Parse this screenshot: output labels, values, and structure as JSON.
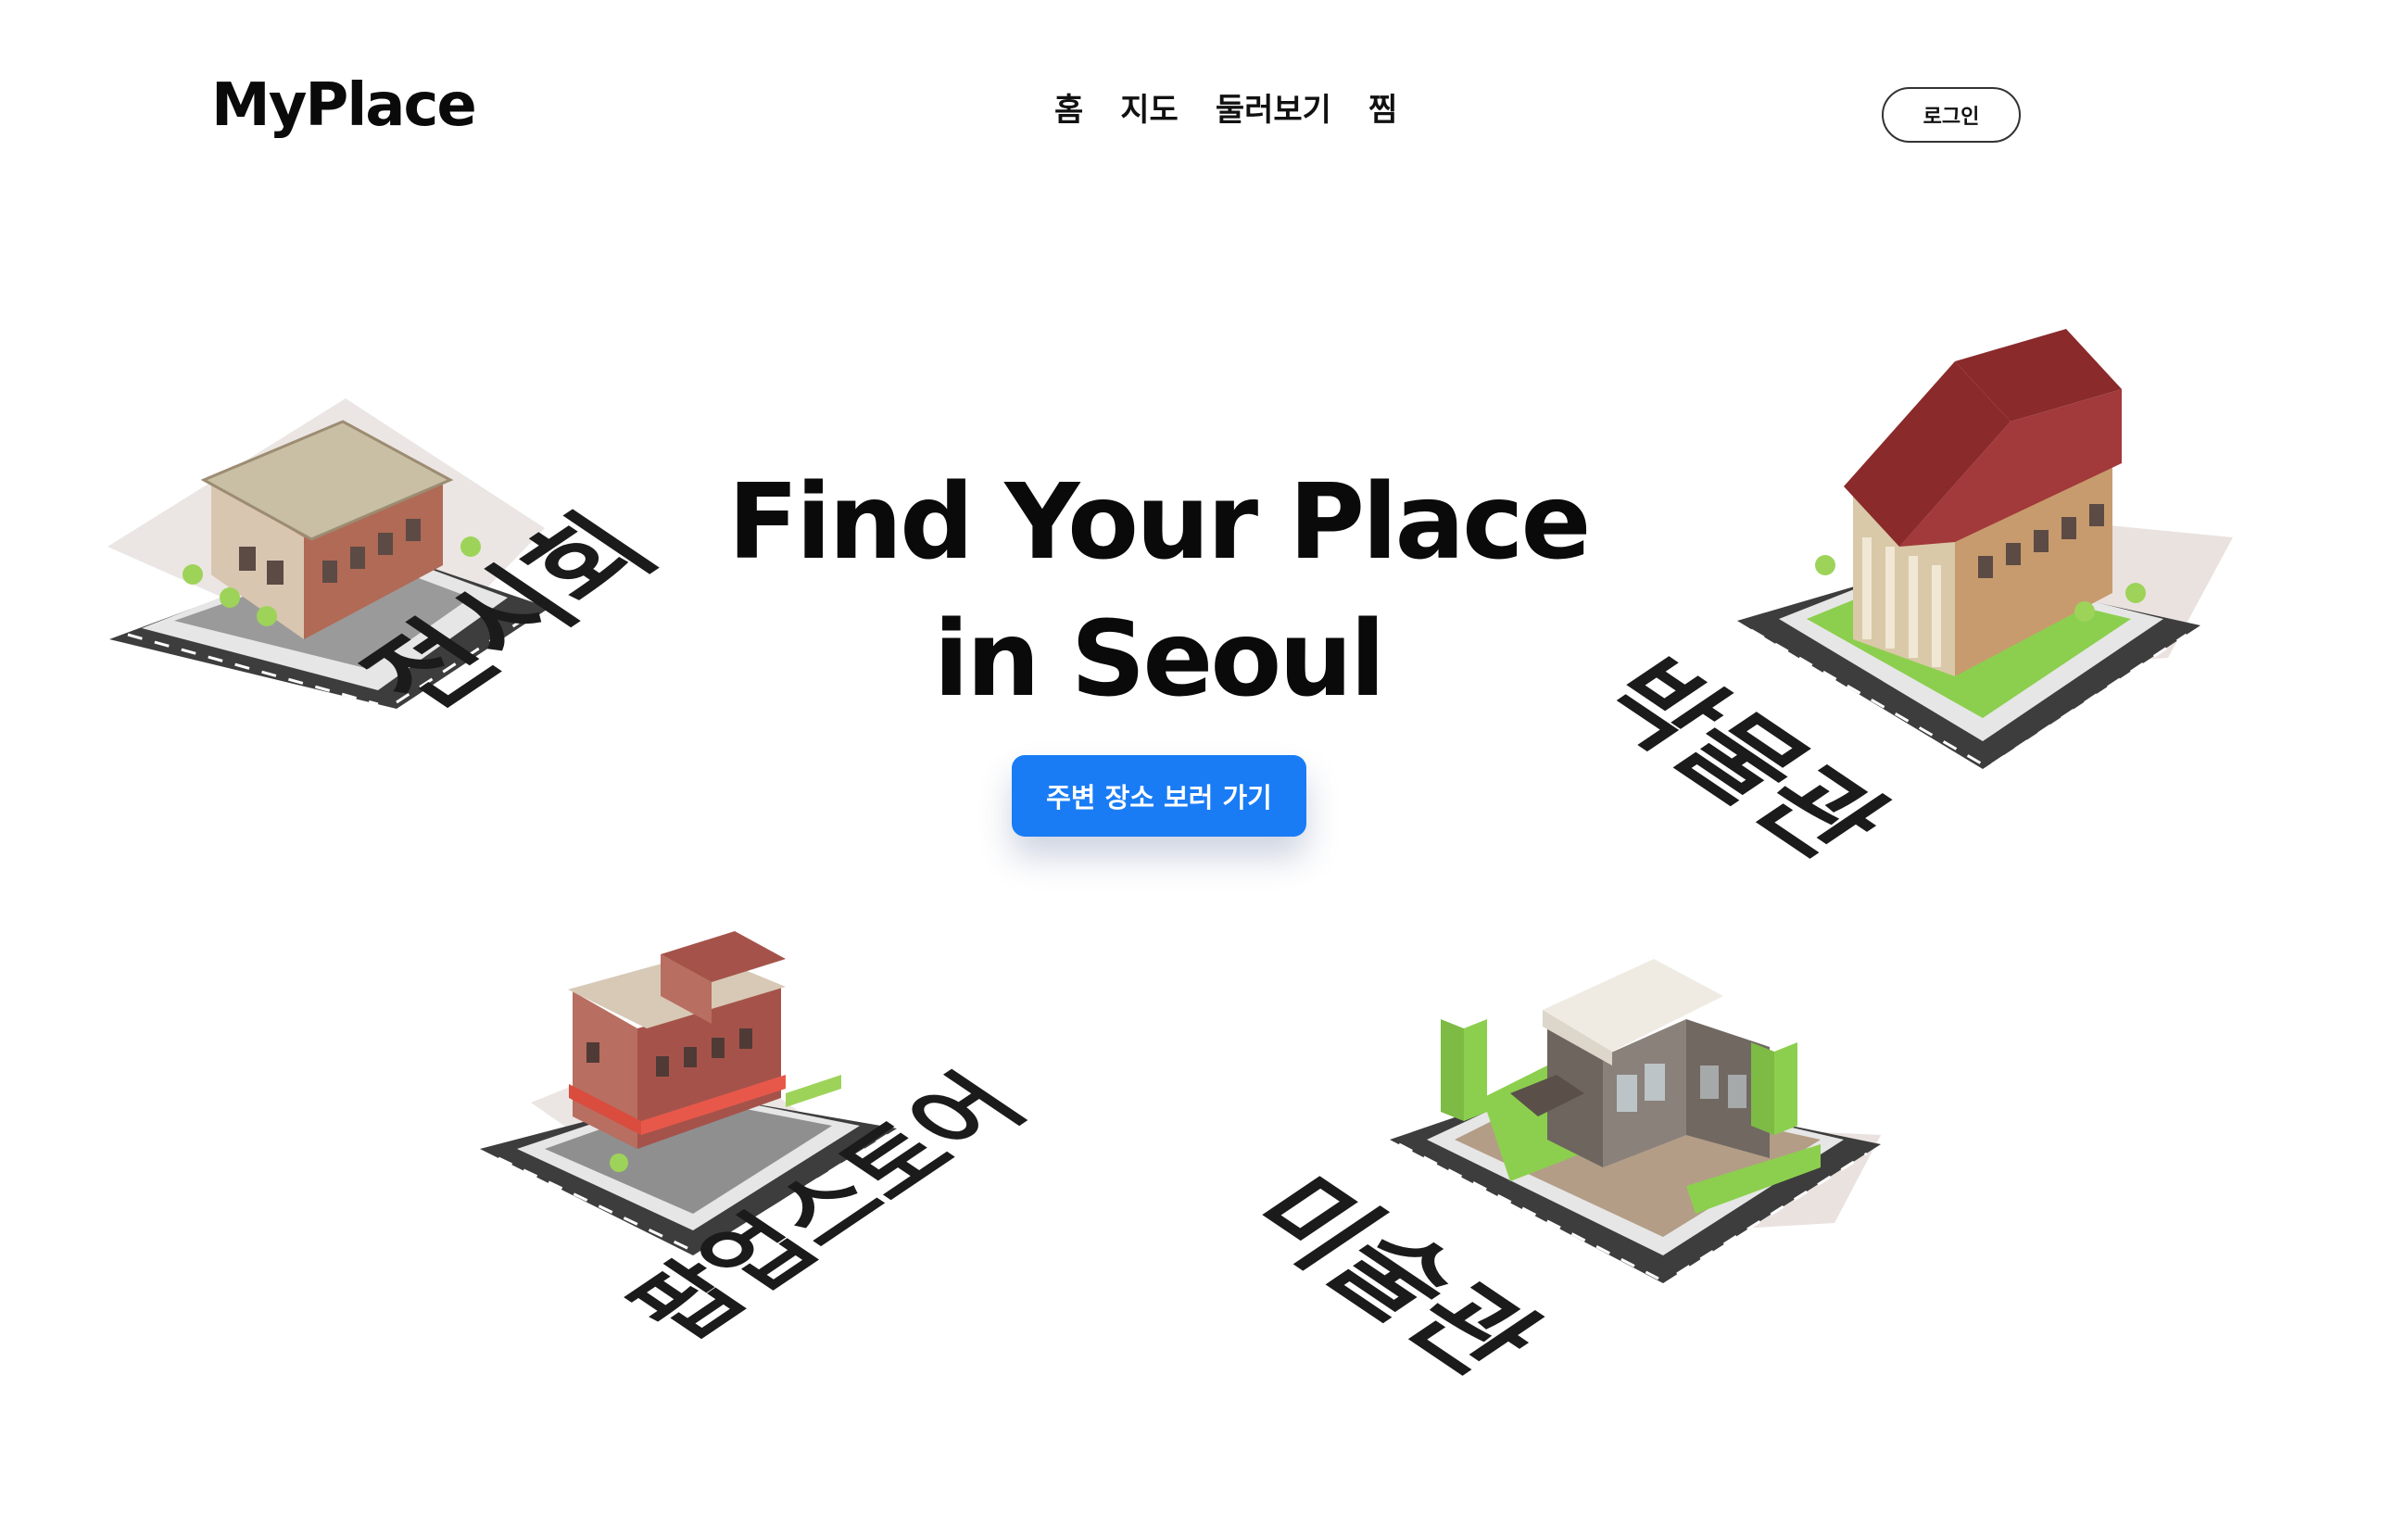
{
  "header": {
    "logo": "MyPlace",
    "nav": [
      "홈",
      "지도",
      "둘러보기",
      "찜"
    ],
    "login_label": "로그인"
  },
  "hero": {
    "title_line1": "Find Your Place",
    "title_line2": "in Seoul",
    "cta_label": "주변 장소 보러 가기"
  },
  "places": {
    "exhibition": "전시회",
    "museum": "박물관",
    "popup_store": "팝업스토어",
    "art_gallery": "미술관"
  },
  "colors": {
    "accent": "#1a7cf5",
    "text": "#0a0a0a",
    "road": "#3d3d3d",
    "grass": "#8ccf4e",
    "museum_roof": "#8a2a2a",
    "gallery_wall": "#efebe3",
    "popup_brick": "#a5534a",
    "exhibition_roof": "#c8bfa4"
  }
}
